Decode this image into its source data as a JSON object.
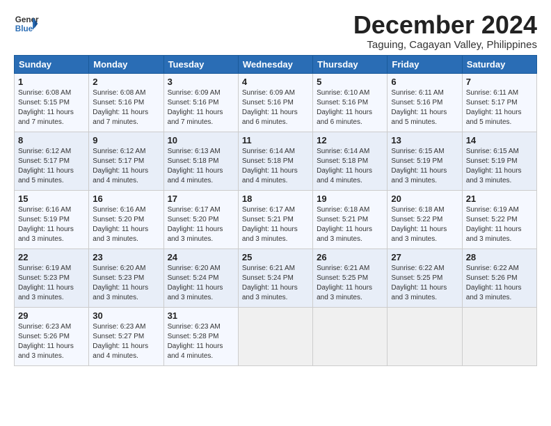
{
  "header": {
    "logo_general": "General",
    "logo_blue": "Blue",
    "month_title": "December 2024",
    "subtitle": "Taguing, Cagayan Valley, Philippines"
  },
  "days_of_week": [
    "Sunday",
    "Monday",
    "Tuesday",
    "Wednesday",
    "Thursday",
    "Friday",
    "Saturday"
  ],
  "weeks": [
    [
      {
        "day": "1",
        "info": "Sunrise: 6:08 AM\nSunset: 5:15 PM\nDaylight: 11 hours and 7 minutes."
      },
      {
        "day": "2",
        "info": "Sunrise: 6:08 AM\nSunset: 5:16 PM\nDaylight: 11 hours and 7 minutes."
      },
      {
        "day": "3",
        "info": "Sunrise: 6:09 AM\nSunset: 5:16 PM\nDaylight: 11 hours and 7 minutes."
      },
      {
        "day": "4",
        "info": "Sunrise: 6:09 AM\nSunset: 5:16 PM\nDaylight: 11 hours and 6 minutes."
      },
      {
        "day": "5",
        "info": "Sunrise: 6:10 AM\nSunset: 5:16 PM\nDaylight: 11 hours and 6 minutes."
      },
      {
        "day": "6",
        "info": "Sunrise: 6:11 AM\nSunset: 5:16 PM\nDaylight: 11 hours and 5 minutes."
      },
      {
        "day": "7",
        "info": "Sunrise: 6:11 AM\nSunset: 5:17 PM\nDaylight: 11 hours and 5 minutes."
      }
    ],
    [
      {
        "day": "8",
        "info": "Sunrise: 6:12 AM\nSunset: 5:17 PM\nDaylight: 11 hours and 5 minutes."
      },
      {
        "day": "9",
        "info": "Sunrise: 6:12 AM\nSunset: 5:17 PM\nDaylight: 11 hours and 4 minutes."
      },
      {
        "day": "10",
        "info": "Sunrise: 6:13 AM\nSunset: 5:18 PM\nDaylight: 11 hours and 4 minutes."
      },
      {
        "day": "11",
        "info": "Sunrise: 6:14 AM\nSunset: 5:18 PM\nDaylight: 11 hours and 4 minutes."
      },
      {
        "day": "12",
        "info": "Sunrise: 6:14 AM\nSunset: 5:18 PM\nDaylight: 11 hours and 4 minutes."
      },
      {
        "day": "13",
        "info": "Sunrise: 6:15 AM\nSunset: 5:19 PM\nDaylight: 11 hours and 3 minutes."
      },
      {
        "day": "14",
        "info": "Sunrise: 6:15 AM\nSunset: 5:19 PM\nDaylight: 11 hours and 3 minutes."
      }
    ],
    [
      {
        "day": "15",
        "info": "Sunrise: 6:16 AM\nSunset: 5:19 PM\nDaylight: 11 hours and 3 minutes."
      },
      {
        "day": "16",
        "info": "Sunrise: 6:16 AM\nSunset: 5:20 PM\nDaylight: 11 hours and 3 minutes."
      },
      {
        "day": "17",
        "info": "Sunrise: 6:17 AM\nSunset: 5:20 PM\nDaylight: 11 hours and 3 minutes."
      },
      {
        "day": "18",
        "info": "Sunrise: 6:17 AM\nSunset: 5:21 PM\nDaylight: 11 hours and 3 minutes."
      },
      {
        "day": "19",
        "info": "Sunrise: 6:18 AM\nSunset: 5:21 PM\nDaylight: 11 hours and 3 minutes."
      },
      {
        "day": "20",
        "info": "Sunrise: 6:18 AM\nSunset: 5:22 PM\nDaylight: 11 hours and 3 minutes."
      },
      {
        "day": "21",
        "info": "Sunrise: 6:19 AM\nSunset: 5:22 PM\nDaylight: 11 hours and 3 minutes."
      }
    ],
    [
      {
        "day": "22",
        "info": "Sunrise: 6:19 AM\nSunset: 5:23 PM\nDaylight: 11 hours and 3 minutes."
      },
      {
        "day": "23",
        "info": "Sunrise: 6:20 AM\nSunset: 5:23 PM\nDaylight: 11 hours and 3 minutes."
      },
      {
        "day": "24",
        "info": "Sunrise: 6:20 AM\nSunset: 5:24 PM\nDaylight: 11 hours and 3 minutes."
      },
      {
        "day": "25",
        "info": "Sunrise: 6:21 AM\nSunset: 5:24 PM\nDaylight: 11 hours and 3 minutes."
      },
      {
        "day": "26",
        "info": "Sunrise: 6:21 AM\nSunset: 5:25 PM\nDaylight: 11 hours and 3 minutes."
      },
      {
        "day": "27",
        "info": "Sunrise: 6:22 AM\nSunset: 5:25 PM\nDaylight: 11 hours and 3 minutes."
      },
      {
        "day": "28",
        "info": "Sunrise: 6:22 AM\nSunset: 5:26 PM\nDaylight: 11 hours and 3 minutes."
      }
    ],
    [
      {
        "day": "29",
        "info": "Sunrise: 6:23 AM\nSunset: 5:26 PM\nDaylight: 11 hours and 3 minutes."
      },
      {
        "day": "30",
        "info": "Sunrise: 6:23 AM\nSunset: 5:27 PM\nDaylight: 11 hours and 4 minutes."
      },
      {
        "day": "31",
        "info": "Sunrise: 6:23 AM\nSunset: 5:28 PM\nDaylight: 11 hours and 4 minutes."
      },
      null,
      null,
      null,
      null
    ]
  ]
}
